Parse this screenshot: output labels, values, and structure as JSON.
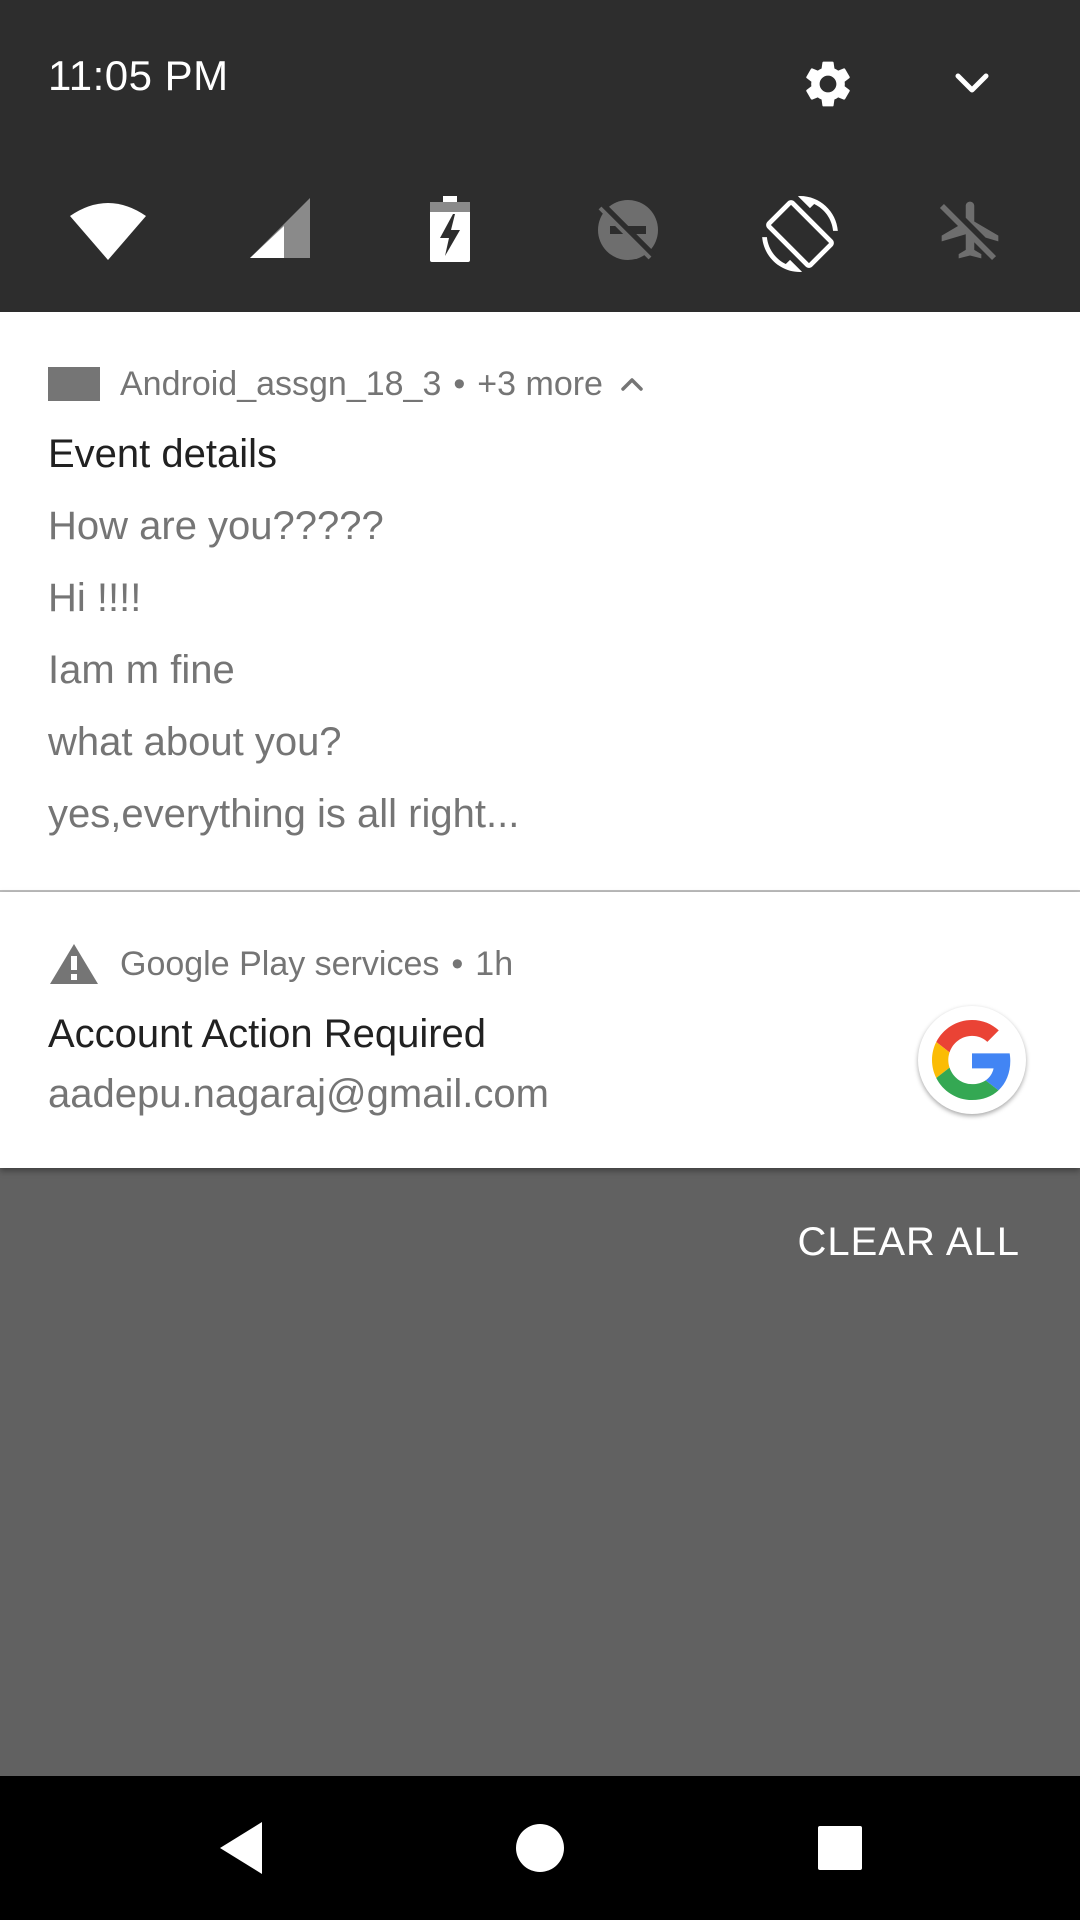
{
  "quick_settings": {
    "time": "11:05 PM",
    "icons": {
      "settings": "gear-icon",
      "expand": "chevron-down-icon"
    },
    "tiles": [
      {
        "name": "wifi-icon"
      },
      {
        "name": "cellular-signal-icon"
      },
      {
        "name": "battery-charging-icon"
      },
      {
        "name": "do-not-disturb-off-icon"
      },
      {
        "name": "auto-rotate-icon"
      },
      {
        "name": "airplane-mode-icon"
      }
    ]
  },
  "notifications": [
    {
      "app": "Android_assgn_18_3",
      "separator": "•",
      "meta": "+3 more",
      "title": "Event details",
      "lines": [
        "How are you?????",
        "Hi !!!!",
        "Iam m fine",
        "what about you?",
        "yes,everything is all right..."
      ]
    },
    {
      "app": "Google Play services",
      "separator": "•",
      "meta": "1h",
      "title": "Account Action Required",
      "lines": [
        "aadepu.nagaraj@gmail.com"
      ]
    }
  ],
  "clear_all": "CLEAR ALL",
  "colors": {
    "header_bg": "#2d2d2d",
    "shade_bg": "#616161",
    "card_bg": "#ffffff",
    "secondary_text": "#757575",
    "primary_text": "#212121"
  }
}
